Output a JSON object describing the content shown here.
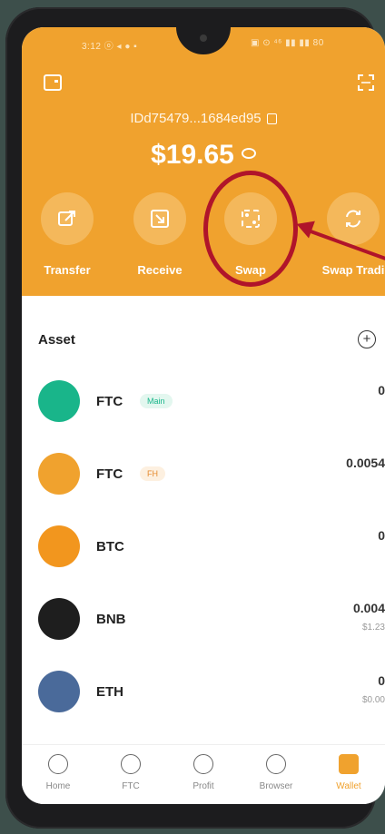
{
  "status_bar": {
    "left": "3:12 ⓞ ◂ ● ▪",
    "right": "▣ ⊙ ⁴⁶ ▮▮ ▮▮ 80"
  },
  "wallet": {
    "address": "IDd75479...1684ed95",
    "balance": "$19.65"
  },
  "actions": [
    {
      "label": "Transfer",
      "icon": "transfer-icon"
    },
    {
      "label": "Receive",
      "icon": "receive-icon"
    },
    {
      "label": "Swap",
      "icon": "swap-icon"
    },
    {
      "label": "Swap Tradi",
      "icon": "swap-trading-icon"
    }
  ],
  "asset_section": {
    "title": "Asset"
  },
  "assets": [
    {
      "symbol": "FTC",
      "tag": "Main",
      "amount": "0",
      "fiat": "",
      "color": "#19b58a"
    },
    {
      "symbol": "FTC",
      "tag": "FH",
      "amount": "0.0054",
      "fiat": "",
      "color": "#f0a22e"
    },
    {
      "symbol": "BTC",
      "tag": "",
      "amount": "0",
      "fiat": "",
      "color": "#f2961e"
    },
    {
      "symbol": "BNB",
      "tag": "",
      "amount": "0.004",
      "fiat": "$1.23",
      "color": "#1e1e1e"
    },
    {
      "symbol": "ETH",
      "tag": "",
      "amount": "0",
      "fiat": "$0.00",
      "color": "#4a6a9a"
    }
  ],
  "nav": [
    {
      "label": "Home",
      "icon": "home-icon"
    },
    {
      "label": "FTC",
      "icon": "ftc-icon"
    },
    {
      "label": "Profit",
      "icon": "profit-icon"
    },
    {
      "label": "Browser",
      "icon": "browser-icon"
    },
    {
      "label": "Wallet",
      "icon": "wallet-icon"
    }
  ],
  "colors": {
    "brand": "#f0a22e",
    "highlight": "#b0142a"
  }
}
